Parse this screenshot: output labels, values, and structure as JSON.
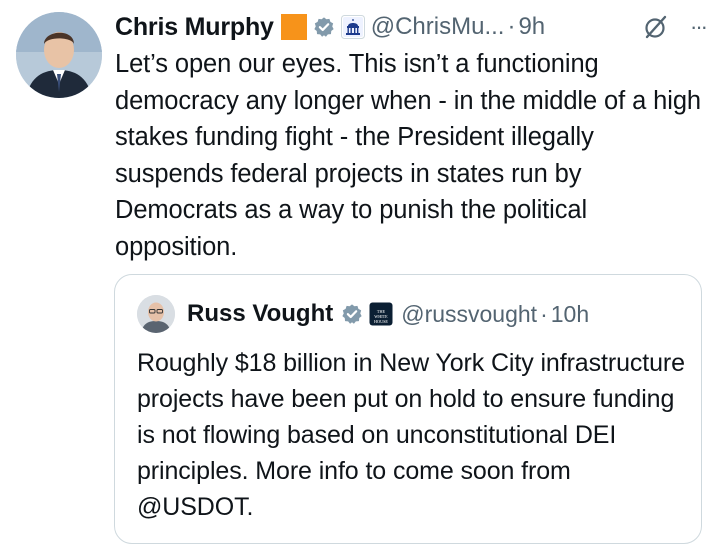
{
  "tweet": {
    "author_name": "Chris Murphy",
    "handle": "@ChrisMu...",
    "separator": "·",
    "time": "9h",
    "text": "Let’s open our eyes. This isn’t a functioning democracy any longer when - in the middle of a high stakes funding fight - the President illegally suspends federal projects in states run by Democrats as a way to punish the political opposition.",
    "more_label": "···",
    "icons": [
      "verified-badge-icon",
      "capitol-affiliation-icon",
      "grok-slash-icon",
      "more-options-icon"
    ]
  },
  "quote": {
    "author_name": "Russ Vought",
    "affiliation_label": "THE WHITE HOUSE",
    "handle": "@russvought",
    "separator": "·",
    "time": "10h",
    "text": "Roughly $18 billion in New York City infrastructure projects have been put on hold to ensure funding is not flowing based on unconstitutional DEI principles. More info to come soon from @USDOT."
  },
  "colors": {
    "text": "#0f1419",
    "secondary": "#536471",
    "verified_gray": "#829aab",
    "orange_badge": "#f7931a",
    "border": "#cfd9de"
  }
}
